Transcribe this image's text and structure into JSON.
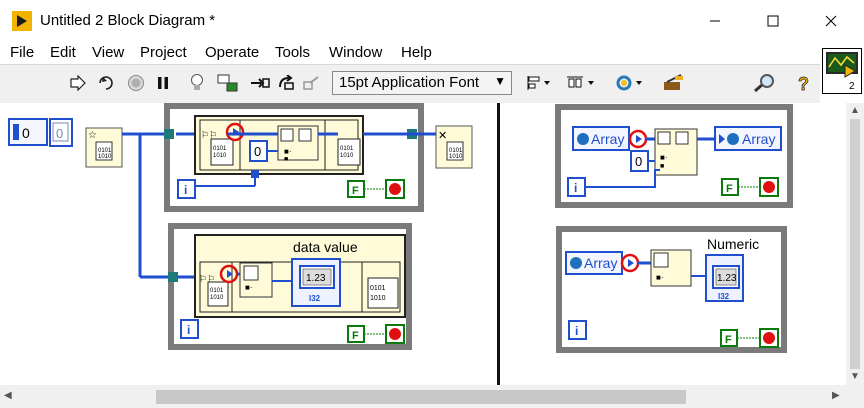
{
  "window": {
    "title": "Untitled 2 Block Diagram *"
  },
  "menu": [
    "File",
    "Edit",
    "View",
    "Project",
    "Operate",
    "Tools",
    "Window",
    "Help"
  ],
  "toolbar": {
    "font_select": "15pt Application Font",
    "vi_icon_number": "2"
  },
  "diagram": {
    "left_constant": "0",
    "left_indicator": "0",
    "inner_constant": "0",
    "data_value_label": "data value",
    "numeric_label": "Numeric",
    "array_label": "Array",
    "iteration": "i",
    "stop_false": "F",
    "numeric_value": "1.23",
    "numeric_type": "I32"
  },
  "colors": {
    "wire_blue": "#1f4fcf",
    "loop_gray": "#808080",
    "stop_red": "#e01010",
    "bool_green": "#0a7a0a",
    "node_fill": "#fffbd8"
  }
}
